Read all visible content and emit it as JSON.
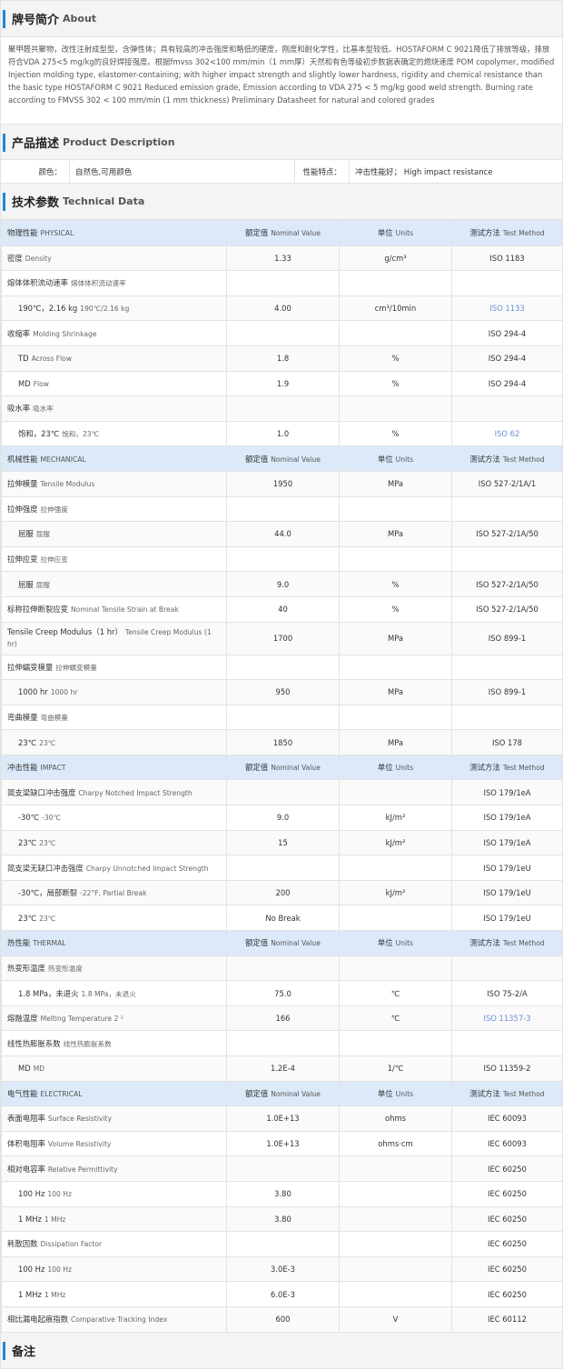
{
  "about": {
    "title_zh": "牌号简介",
    "title_en": "About",
    "text": "聚甲醛共聚物，改性注射成型型，含弹性体；具有较高的冲击强度和略低的硬度，刚度和耐化学性，比基本型较低。HOSTAFORM C 9021降低了排放等级，排放符合VDA 275<5 mg/kg的良好焊接强度。根据fmvss 302<100 mm/min（1 mm厚）天然和有色等级初步数据表确定的燃烧速度 POM copolymer, modified Injection molding type, elastomer-containing; with higher impact strength and slightly lower hardness, rigidity and chemical resistance than the basic type HOSTAFORM C 9021 Reduced emission grade, Emission according to VDA 275 < 5 mg/kg good weld strength. Burning rate according to FMVSS 302 < 100 mm/min (1 mm thickness) Preliminary Datasheet for natural and colored grades"
  },
  "description": {
    "title_zh": "产品描述",
    "title_en": "Product Description",
    "color_label": "颜色：",
    "color_value": "自然色,可用颜色",
    "feature_label": "性能特点：",
    "feature_value": "冲击性能好； High impact resistance"
  },
  "technical": {
    "title_zh": "技术参数",
    "title_en": "Technical Data",
    "rows": [
      {
        "type": "cat",
        "zh": "物理性能",
        "en": "PHYSICAL",
        "v_zh": "额定值",
        "v_en": "Nominal Value",
        "u_zh": "单位",
        "u_en": "Units",
        "m_zh": "测试方法",
        "m_en": "Test Method"
      },
      {
        "zh": "密度",
        "en": "Density",
        "value": "1.33",
        "unit": "g/cm³",
        "method": "ISO 1183"
      },
      {
        "zh": "熔体体积流动速率",
        "en": "熔体体积流动速率",
        "value": "",
        "unit": "",
        "method": ""
      },
      {
        "sub": true,
        "zh": "190℃，2.16 kg",
        "en": "190℃/2.16 kg",
        "value": "4.00",
        "unit": "cm³/10min",
        "method": "ISO 1133",
        "link": true
      },
      {
        "zh": "收缩率",
        "en": "Molding Shrinkage",
        "value": "",
        "unit": "",
        "method": "ISO 294-4"
      },
      {
        "sub": true,
        "zh": "TD",
        "en": "Across Flow",
        "value": "1.8",
        "unit": "%",
        "method": "ISO 294-4"
      },
      {
        "sub": true,
        "zh": "MD",
        "en": "Flow",
        "value": "1.9",
        "unit": "%",
        "method": "ISO 294-4"
      },
      {
        "zh": "吸水率",
        "en": "吸水率",
        "value": "",
        "unit": "",
        "method": ""
      },
      {
        "sub": true,
        "zh": "饱和，23℃",
        "en": "饱和，23℃",
        "value": "1.0",
        "unit": "%",
        "method": "ISO 62",
        "link": true
      },
      {
        "type": "cat",
        "zh": "机械性能",
        "en": "MECHANICAL",
        "v_zh": "额定值",
        "v_en": "Nominal Value",
        "u_zh": "单位",
        "u_en": "Units",
        "m_zh": "测试方法",
        "m_en": "Test Method"
      },
      {
        "zh": "拉伸模量",
        "en": "Tensile Modulus",
        "value": "1950",
        "unit": "MPa",
        "method": "ISO 527-2/1A/1"
      },
      {
        "zh": "拉伸强度",
        "en": "拉伸强度",
        "value": "",
        "unit": "",
        "method": ""
      },
      {
        "sub": true,
        "zh": "屈服",
        "en": "屈服",
        "value": "44.0",
        "unit": "MPa",
        "method": "ISO 527-2/1A/50"
      },
      {
        "zh": "拉伸应变",
        "en": "拉伸应变",
        "value": "",
        "unit": "",
        "method": ""
      },
      {
        "sub": true,
        "zh": "屈服",
        "en": "屈服",
        "value": "9.0",
        "unit": "%",
        "method": "ISO 527-2/1A/50"
      },
      {
        "zh": "标称拉伸断裂应变",
        "en": "Nominal Tensile Strain at Break",
        "value": "40",
        "unit": "%",
        "method": "ISO 527-2/1A/50"
      },
      {
        "zh": "Tensile Creep Modulus（1 hr）",
        "en": "Tensile Creep Modulus (1 hr)",
        "value": "1700",
        "unit": "MPa",
        "method": "ISO 899-1",
        "tall": true
      },
      {
        "zh": "拉伸蠕变模量",
        "en": "拉伸蠕变模量",
        "value": "",
        "unit": "",
        "method": ""
      },
      {
        "sub": true,
        "zh": "1000 hr",
        "en": "1000 hr",
        "value": "950",
        "unit": "MPa",
        "method": "ISO 899-1"
      },
      {
        "zh": "弯曲模量",
        "en": "弯曲模量",
        "value": "",
        "unit": "",
        "method": ""
      },
      {
        "sub": true,
        "zh": "23℃",
        "en": "23℃",
        "value": "1850",
        "unit": "MPa",
        "method": "ISO 178"
      },
      {
        "type": "cat",
        "zh": "冲击性能",
        "en": "IMPACT",
        "v_zh": "额定值",
        "v_en": "Nominal Value",
        "u_zh": "单位",
        "u_en": "Units",
        "m_zh": "测试方法",
        "m_en": "Test Method"
      },
      {
        "zh": "简支梁缺口冲击强度",
        "en": "Charpy Notched Impact Strength",
        "value": "",
        "unit": "",
        "method": "ISO 179/1eA"
      },
      {
        "sub": true,
        "zh": "-30℃",
        "en": "-30℃",
        "value": "9.0",
        "unit": "kJ/m²",
        "method": "ISO 179/1eA"
      },
      {
        "sub": true,
        "zh": "23℃",
        "en": "23℃",
        "value": "15",
        "unit": "kJ/m²",
        "method": "ISO 179/1eA"
      },
      {
        "zh": "简支梁无缺口冲击强度",
        "en": "Charpy Unnotched Impact Strength",
        "value": "",
        "unit": "",
        "method": "ISO 179/1eU"
      },
      {
        "sub": true,
        "zh": "-30℃，局部断裂",
        "en": "-22°F, Partial Break",
        "value": "200",
        "unit": "kJ/m²",
        "method": "ISO 179/1eU"
      },
      {
        "sub": true,
        "zh": "23℃",
        "en": "23℃",
        "value": "No Break",
        "unit": "",
        "method": "ISO 179/1eU"
      },
      {
        "type": "cat",
        "zh": "热性能",
        "en": "THERMAL",
        "v_zh": "额定值",
        "v_en": "Nominal Value",
        "u_zh": "单位",
        "u_en": "Units",
        "m_zh": "测试方法",
        "m_en": "Test Method"
      },
      {
        "zh": "热变形温度",
        "en": "热变形温度",
        "value": "",
        "unit": "",
        "method": ""
      },
      {
        "sub": true,
        "zh": "1.8 MPa，未退火",
        "en": "1.8 MPa，未退火",
        "value": "75.0",
        "unit": "℃",
        "method": "ISO 75-2/A"
      },
      {
        "zh": "熔融温度",
        "en": "Melting Temperature  2 ²",
        "value": "166",
        "unit": "℃",
        "method": "ISO 11357-3",
        "link": true
      },
      {
        "zh": "线性热膨胀系数",
        "en": "线性热膨胀系数",
        "value": "",
        "unit": "",
        "method": ""
      },
      {
        "sub": true,
        "zh": "MD",
        "en": "MD",
        "value": "1.2E-4",
        "unit": "1/℃",
        "method": "ISO 11359-2"
      },
      {
        "type": "cat",
        "zh": "电气性能",
        "en": "ELECTRICAL",
        "v_zh": "额定值",
        "v_en": "Nominal Value",
        "u_zh": "单位",
        "u_en": "Units",
        "m_zh": "测试方法",
        "m_en": "Test Method"
      },
      {
        "zh": "表面电阻率",
        "en": "Surface Resistivity",
        "value": "1.0E+13",
        "unit": "ohms",
        "method": "IEC 60093"
      },
      {
        "zh": "体积电阻率",
        "en": "Volume Resistivity",
        "value": "1.0E+13",
        "unit": "ohms·cm",
        "method": "IEC 60093"
      },
      {
        "zh": "相对电容率",
        "en": "Relative Permittivity",
        "value": "",
        "unit": "",
        "method": "IEC 60250"
      },
      {
        "sub": true,
        "zh": "100 Hz",
        "en": "100 Hz",
        "value": "3.80",
        "unit": "",
        "method": "IEC 60250"
      },
      {
        "sub": true,
        "zh": "1 MHz",
        "en": "1 MHz",
        "value": "3.80",
        "unit": "",
        "method": "IEC 60250"
      },
      {
        "zh": "耗散因数",
        "en": "Dissipation Factor",
        "value": "",
        "unit": "",
        "method": "IEC 60250"
      },
      {
        "sub": true,
        "zh": "100 Hz",
        "en": "100 Hz",
        "value": "3.0E-3",
        "unit": "",
        "method": "IEC 60250"
      },
      {
        "sub": true,
        "zh": "1 MHz",
        "en": "1 MHz",
        "value": "6.0E-3",
        "unit": "",
        "method": "IEC 60250"
      },
      {
        "zh": "相比漏电起痕指数",
        "en": "Comparative Tracking Index",
        "value": "600",
        "unit": "V",
        "method": "IEC 60112"
      }
    ]
  },
  "notes": {
    "title_zh": "备注"
  }
}
